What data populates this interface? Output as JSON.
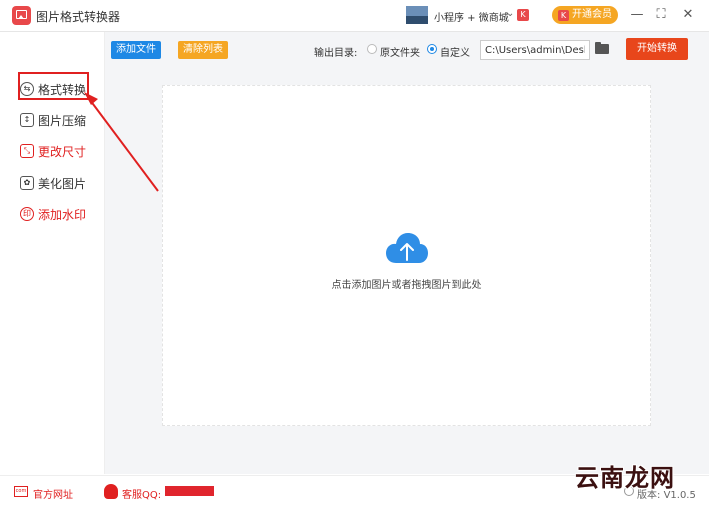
{
  "app": {
    "title": "图片格式转换器"
  },
  "header": {
    "mini_program_label": "小程序 + 微商城",
    "mini_badge": "K",
    "vip_label": "开通会员",
    "vip_badge": "K"
  },
  "sidebar": {
    "items": [
      {
        "label": "格式转换",
        "icon": "format-convert-icon",
        "color": "#333333"
      },
      {
        "label": "图片压缩",
        "icon": "compress-icon",
        "color": "#333333"
      },
      {
        "label": "更改尺寸",
        "icon": "resize-icon",
        "color": "#e02020"
      },
      {
        "label": "美化图片",
        "icon": "beautify-icon",
        "color": "#333333"
      },
      {
        "label": "添加水印",
        "icon": "watermark-icon",
        "color": "#e02020"
      }
    ]
  },
  "toolbar": {
    "add_file": "添加文件",
    "clear_list": "清除列表",
    "output_dir_label": "输出目录:",
    "option_original": "原文件夹",
    "option_custom": "自定义",
    "path_value": "C:\\Users\\admin\\Deskto",
    "start_button": "开始转换"
  },
  "dropzone": {
    "hint": "点击添加图片或者拖拽图片到此处"
  },
  "statusbar": {
    "website_label": "官方网址",
    "support_label": "客服QQ:",
    "version_label": "版本:",
    "version_value": "V1.0.5"
  },
  "watermark": "云南龙网",
  "colors": {
    "accent_blue": "#1e88e5",
    "accent_orange": "#f5a623",
    "start_red": "#e8461b",
    "highlight_red": "#e02020"
  }
}
